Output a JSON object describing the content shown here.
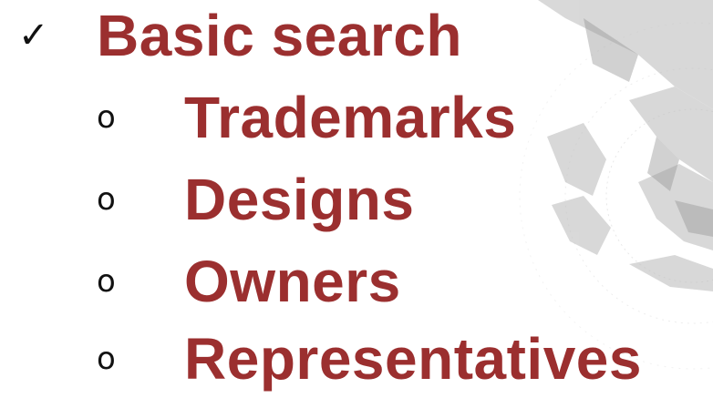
{
  "icons": {
    "main": "checkmark-icon",
    "sub": "hollow-circle-bullet-icon"
  },
  "colors": {
    "text": "#9b2f2f",
    "bullet": "#111111"
  },
  "list": {
    "checkmark": "✓",
    "title": "Basic search",
    "bullet": "o",
    "items": [
      "Trademarks",
      "Designs",
      "Owners",
      "Representatives"
    ]
  }
}
